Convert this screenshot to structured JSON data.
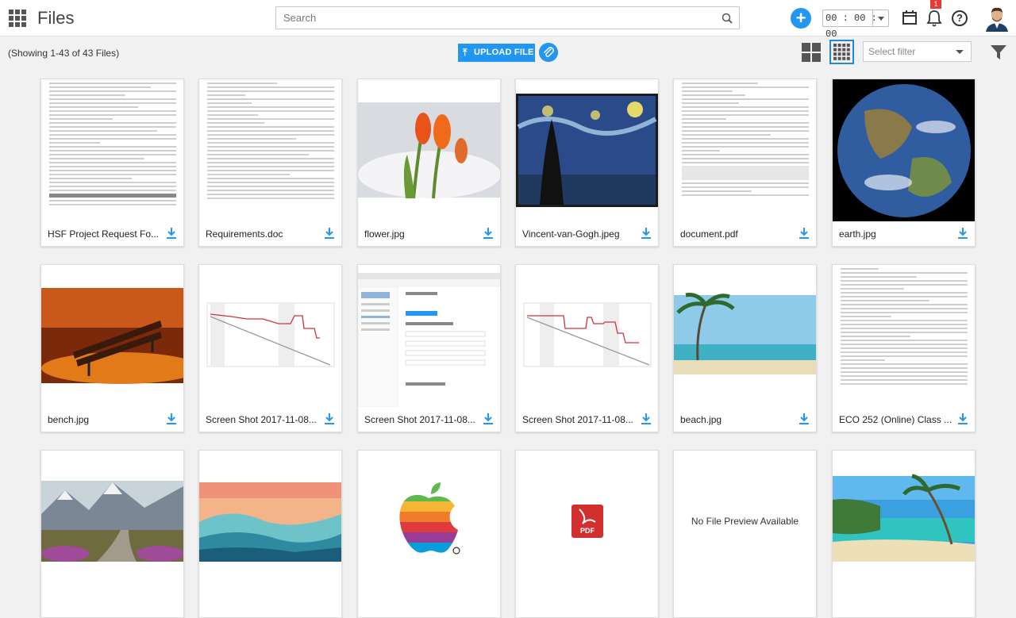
{
  "app": {
    "title": "Files"
  },
  "search": {
    "placeholder": "Search"
  },
  "timer": {
    "value": "00 : 00 : 00"
  },
  "notifications": {
    "count": "1"
  },
  "help": {
    "label": "?"
  },
  "toolbar": {
    "showing": "(Showing 1-43 of 43 Files)",
    "upload_label": "UPLOAD FILE",
    "filter_placeholder": "Select filter"
  },
  "colors": {
    "accent": "#2196f3",
    "badge": "#e53935"
  },
  "files": [
    {
      "name": "HSF Project Request Fo...",
      "thumb": "document"
    },
    {
      "name": "Requirements.doc",
      "thumb": "document"
    },
    {
      "name": "flower.jpg",
      "thumb": "image"
    },
    {
      "name": "Vincent-van-Gogh.jpeg",
      "thumb": "image"
    },
    {
      "name": "document.pdf",
      "thumb": "document"
    },
    {
      "name": "earth.jpg",
      "thumb": "image"
    },
    {
      "name": "bench.jpg",
      "thumb": "image"
    },
    {
      "name": "Screen Shot 2017-11-08...",
      "thumb": "chart"
    },
    {
      "name": "Screen Shot 2017-11-08...",
      "thumb": "screenshot"
    },
    {
      "name": "Screen Shot 2017-11-08...",
      "thumb": "chart"
    },
    {
      "name": "beach.jpg",
      "thumb": "image"
    },
    {
      "name": "ECO 252 (Online) Class ...",
      "thumb": "document"
    },
    {
      "name": "",
      "thumb": "image"
    },
    {
      "name": "",
      "thumb": "image"
    },
    {
      "name": "",
      "thumb": "apple-logo"
    },
    {
      "name": "",
      "thumb": "pdf-icon"
    },
    {
      "name": "",
      "thumb": "no-preview",
      "preview_text": "No File Preview Available"
    },
    {
      "name": "",
      "thumb": "image"
    }
  ]
}
